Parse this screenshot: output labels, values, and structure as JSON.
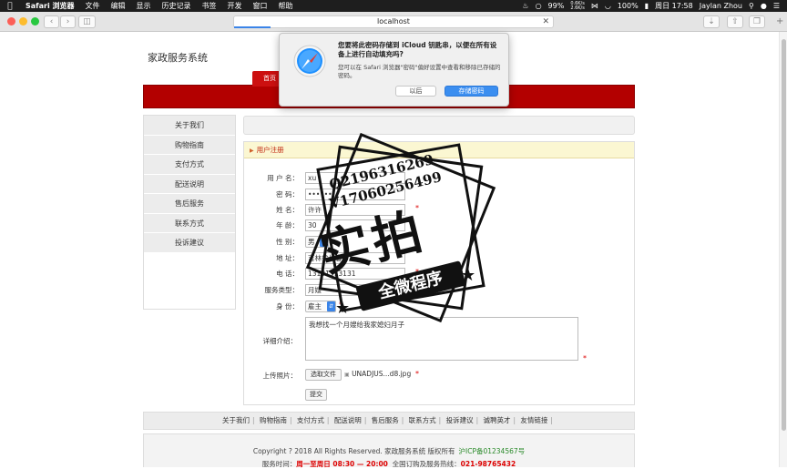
{
  "menubar": {
    "app_name": "Safari 浏览器",
    "items": [
      "文件",
      "编辑",
      "显示",
      "历史记录",
      "书签",
      "开发",
      "窗口",
      "帮助"
    ],
    "battery": "99%",
    "net_up": "0.6K/s",
    "net_down": "2.6K/s",
    "battery2": "100%",
    "datetime": "周日 17:58",
    "user": "Jaylan Zhou"
  },
  "browser": {
    "address": "localhost"
  },
  "dialog": {
    "title": "您要将此密码存储到 iCloud 钥匙串，以便在所有设备上进行自动填充吗?",
    "body": "您可以在 Safari 浏览器\"密码\"偏好设置中查看和移除已存储的密码。",
    "later_label": "以后",
    "save_label": "存储密码"
  },
  "site": {
    "title": "家政服务系统",
    "nav_home": "首页"
  },
  "left_nav": {
    "items": [
      "关于我们",
      "购物指南",
      "支付方式",
      "配送说明",
      "售后服务",
      "联系方式",
      "投诉建议"
    ]
  },
  "form": {
    "header": "用户注册",
    "fields": {
      "username": {
        "label": "用 户 名：",
        "value": "xu"
      },
      "password": {
        "label": "密  码：",
        "value": "••••••"
      },
      "name": {
        "label": "姓  名：",
        "value": "许许"
      },
      "age": {
        "label": "年  龄：",
        "value": "30"
      },
      "gender": {
        "label": "性  别：",
        "value": "男"
      },
      "address": {
        "label": "地  址：",
        "value": "吉林省长春市"
      },
      "phone": {
        "label": "电  话：",
        "value": "13131313131"
      },
      "service_type": {
        "label": "服务类型：",
        "value": "月嫂"
      },
      "identity": {
        "label": "身  份：",
        "value": "雇主"
      },
      "detail": {
        "label": "详细介绍：",
        "value": "我想找一个月嫂给我家媳妇月子"
      },
      "photo": {
        "label": "上传照片：",
        "button": "选取文件",
        "file": "UNADJUS...d8.jpg"
      }
    },
    "submit_label": "提交"
  },
  "footer": {
    "links": [
      "关于我们",
      "购物指南",
      "支付方式",
      "配送说明",
      "售后服务",
      "联系方式",
      "投诉建议",
      "诚聘英才",
      "友情链接"
    ],
    "copyright": "Copyright ? 2018 All Rights Reserved. 家政服务系统 版权所有",
    "icp": "沪ICP备01234567号",
    "service_prefix": "服务时间：",
    "service_time": "周一至周日 08:30 — 20:00",
    "hotline_prefix": "全国订购及服务热线：",
    "hotline": "021-98765432"
  },
  "watermark": {
    "qq": "Q2196316269",
    "wx": "V17060256499",
    "main": "实拍",
    "band": "全微程序"
  }
}
